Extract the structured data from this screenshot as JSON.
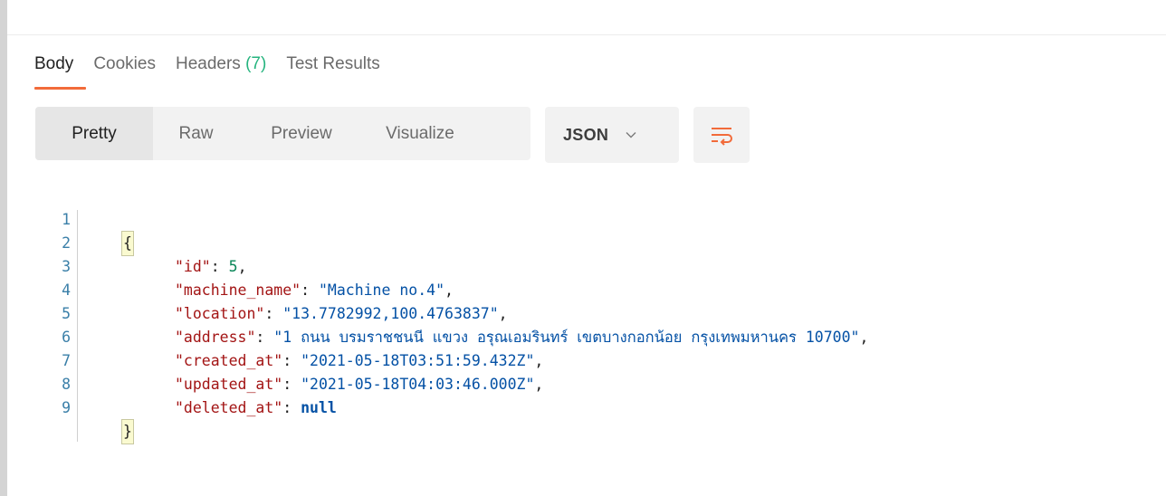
{
  "response_tabs": [
    {
      "label": "Body",
      "active": true
    },
    {
      "label": "Cookies",
      "active": false
    },
    {
      "label": "Headers ",
      "count": "(7)",
      "active": false
    },
    {
      "label": "Test Results",
      "active": false
    }
  ],
  "view_modes": [
    "Pretty",
    "Raw",
    "Preview",
    "Visualize"
  ],
  "active_view": "Pretty",
  "format": {
    "selected": "JSON",
    "icon": "chevron-down-icon"
  },
  "wrap_icon": "word-wrap-icon",
  "colors": {
    "accent": "#f26b3a",
    "count": "#26b47f",
    "key": "#a31515",
    "string": "#0451a5",
    "number": "#098658",
    "line_number": "#3a7fa8"
  },
  "code": {
    "line_numbers": [
      "1",
      "2",
      "3",
      "4",
      "5",
      "6",
      "7",
      "8",
      "9"
    ],
    "open_brace": "{",
    "close_brace": "}",
    "entries": [
      {
        "key": "\"id\"",
        "sep": ": ",
        "value": "5",
        "type": "number",
        "trail": ","
      },
      {
        "key": "\"machine_name\"",
        "sep": ": ",
        "value": "\"Machine no.4\"",
        "type": "string",
        "trail": ","
      },
      {
        "key": "\"location\"",
        "sep": ": ",
        "value": "\"13.7782992,100.4763837\"",
        "type": "string",
        "trail": ","
      },
      {
        "key": "\"address\"",
        "sep": ": ",
        "value": "\"1 ถนน บรมราชชนนี แขวง อรุณเอมรินทร์ เขตบางกอกน้อย กรุงเทพมหานคร 10700\"",
        "type": "string",
        "trail": ","
      },
      {
        "key": "\"created_at\"",
        "sep": ": ",
        "value": "\"2021-05-18T03:51:59.432Z\"",
        "type": "string",
        "trail": ","
      },
      {
        "key": "\"updated_at\"",
        "sep": ": ",
        "value": "\"2021-05-18T04:03:46.000Z\"",
        "type": "string",
        "trail": ","
      },
      {
        "key": "\"deleted_at\"",
        "sep": ": ",
        "value": "null",
        "type": "keyword",
        "trail": ""
      }
    ]
  }
}
